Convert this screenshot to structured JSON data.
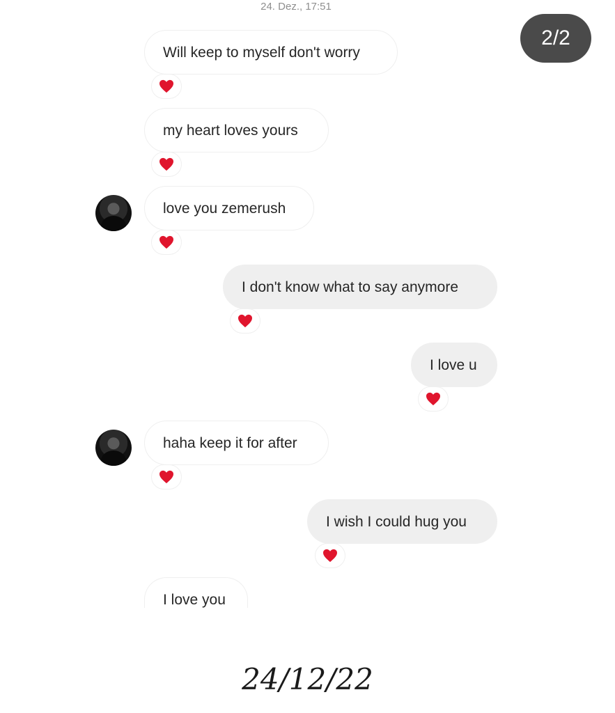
{
  "header": {
    "timestamp": "24. Dez., 17:51",
    "page_counter": "2/2"
  },
  "messages": [
    {
      "direction": "incoming",
      "text": "Will keep to myself don't worry",
      "reaction": "heart-icon",
      "avatar": false
    },
    {
      "direction": "incoming",
      "text": "my heart loves yours",
      "reaction": "heart-icon",
      "avatar": false
    },
    {
      "direction": "incoming",
      "text": "love you zemerush",
      "reaction": "heart-icon",
      "avatar": true
    },
    {
      "direction": "outgoing",
      "text": "I don't know what to say anymore",
      "reaction": "heart-icon"
    },
    {
      "direction": "outgoing",
      "text": "I love u",
      "reaction": "heart-icon"
    },
    {
      "direction": "incoming",
      "text": "haha keep it for after",
      "reaction": "heart-icon",
      "avatar": true
    },
    {
      "direction": "outgoing",
      "text": "I wish I could hug you",
      "reaction": "heart-icon"
    },
    {
      "direction": "incoming",
      "text": "I love you",
      "reaction": null,
      "avatar": false
    }
  ],
  "caption": {
    "date": "24/12/22"
  },
  "colors": {
    "heart": "#e0152d",
    "outgoing_bubble": "#efefef",
    "incoming_border": "#efefef",
    "page_counter_bg": "#4a4a4a"
  }
}
